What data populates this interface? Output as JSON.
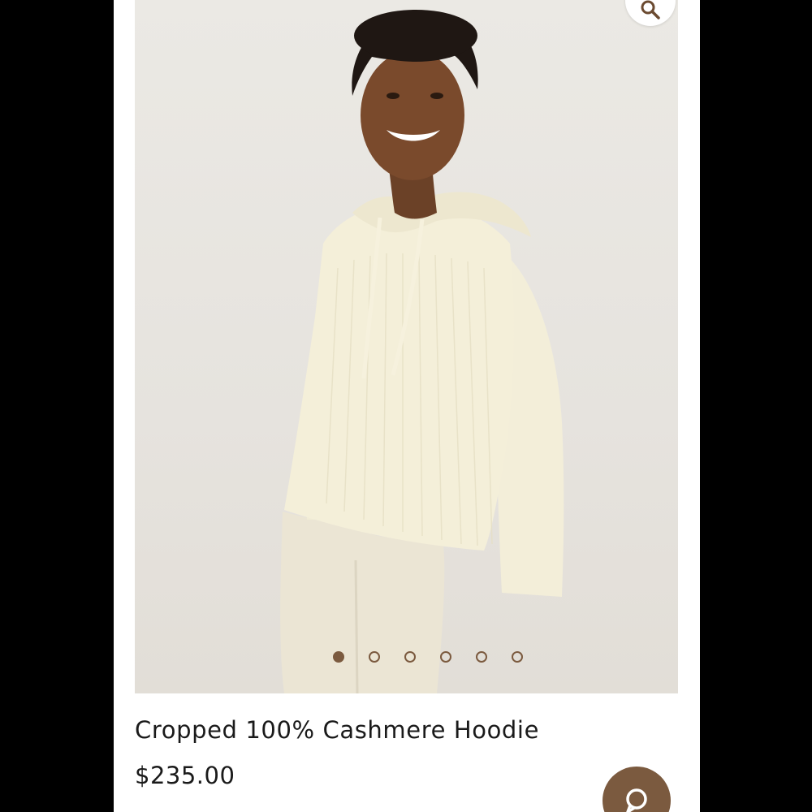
{
  "product": {
    "title": "Cropped 100% Cashmere Hoodie",
    "price": "$235.00"
  },
  "gallery": {
    "image_count": 6,
    "active_index": 0,
    "dot_color": "#7b5a3f"
  },
  "icons": {
    "zoom": "magnifier-icon",
    "chat": "chat-bubble-icon"
  },
  "colors": {
    "accent": "#7b5a3f",
    "text": "#1a1a1a",
    "background": "#ffffff"
  }
}
